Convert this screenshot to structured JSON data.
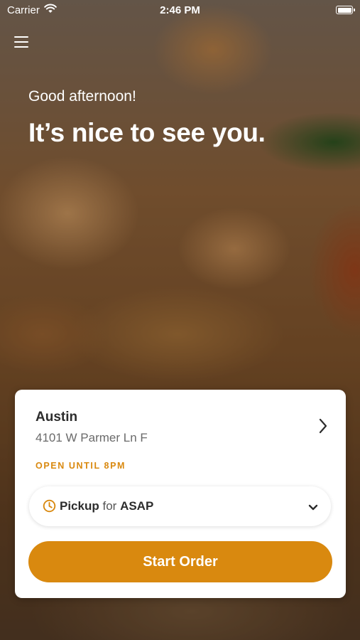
{
  "status_bar": {
    "carrier": "Carrier",
    "time": "2:46 PM"
  },
  "header": {
    "greeting": "Good afternoon!",
    "headline": "It’s nice to see you."
  },
  "location": {
    "name": "Austin",
    "address": "4101 W Parmer Ln F",
    "open_status": "OPEN UNTIL 8PM"
  },
  "order_mode": {
    "method": "Pickup",
    "connector": "for",
    "time": "ASAP"
  },
  "cta": {
    "label": "Start Order"
  },
  "colors": {
    "accent": "#d9890f",
    "card_bg": "#ffffff",
    "text": "#2c2c2c"
  },
  "icons": [
    "wifi-icon",
    "battery-icon",
    "menu-icon",
    "chevron-right-icon",
    "clock-icon",
    "chevron-down-icon"
  ]
}
